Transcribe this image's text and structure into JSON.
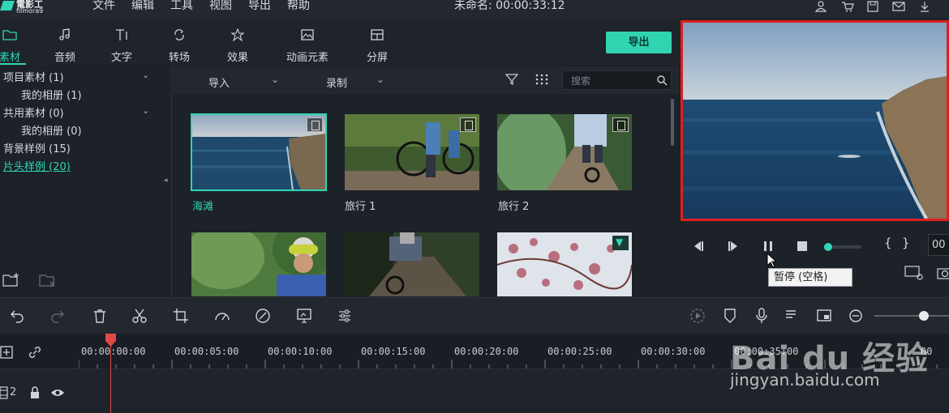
{
  "app": {
    "logo_line1": "電影工",
    "logo_line2": "filmora9",
    "project_title": "未命名: 00:00:33:12"
  },
  "menu": [
    "文件",
    "编辑",
    "工具",
    "视图",
    "导出",
    "帮助"
  ],
  "top_icons": [
    "user-icon",
    "cart-icon",
    "save-icon",
    "mail-icon",
    "download-icon"
  ],
  "tabs": [
    {
      "label": "素材",
      "icon": "folder-icon",
      "active": true
    },
    {
      "label": "音频",
      "icon": "music-note-icon"
    },
    {
      "label": "文字",
      "icon": "text-icon"
    },
    {
      "label": "转场",
      "icon": "transition-icon"
    },
    {
      "label": "效果",
      "icon": "effects-icon"
    },
    {
      "label": "动画元素",
      "icon": "image-icon"
    },
    {
      "label": "分屏",
      "icon": "split-screen-icon"
    }
  ],
  "export_label": "导出",
  "tree": [
    {
      "label": "项目素材 (1)",
      "level": 0,
      "chevron": true
    },
    {
      "label": "我的相册 (1)",
      "level": 1
    },
    {
      "label": "共用素材 (0)",
      "level": 0,
      "chevron": true
    },
    {
      "label": "我的相册 (0)",
      "level": 1
    },
    {
      "label": "背景样例 (15)",
      "level": 0
    },
    {
      "label": "片头样例 (20)",
      "level": 0,
      "selected": true
    }
  ],
  "media_toolbar": {
    "import_label": "导入",
    "record_label": "录制",
    "search_placeholder": "搜索"
  },
  "media": [
    {
      "label": "海滩",
      "selected": true,
      "badge": "film"
    },
    {
      "label": "旅行 1",
      "badge": "film"
    },
    {
      "label": "旅行 2",
      "badge": "film"
    },
    {
      "label": "",
      "badge": "none"
    },
    {
      "label": "",
      "badge": "none"
    },
    {
      "label": "",
      "badge": "download"
    }
  ],
  "preview": {
    "tooltip": "暂停 (空格)",
    "timecode": "00",
    "progress": 0.0
  },
  "timeline": {
    "ruler_labels": [
      "00:00:00:00",
      "00:00:05:00",
      "00:00:10:00",
      "00:00:15:00",
      "00:00:20:00",
      "00:00:25:00",
      "00:00:30:00",
      "00:00:35:00",
      "00"
    ],
    "track_label": "2"
  },
  "watermark": {
    "main": "Bai du 经验",
    "sub": "jingyan.baidu.com"
  },
  "colors": {
    "accent": "#2fd6b5",
    "highlight_border": "#e01e1e",
    "playhead": "#e04848"
  }
}
